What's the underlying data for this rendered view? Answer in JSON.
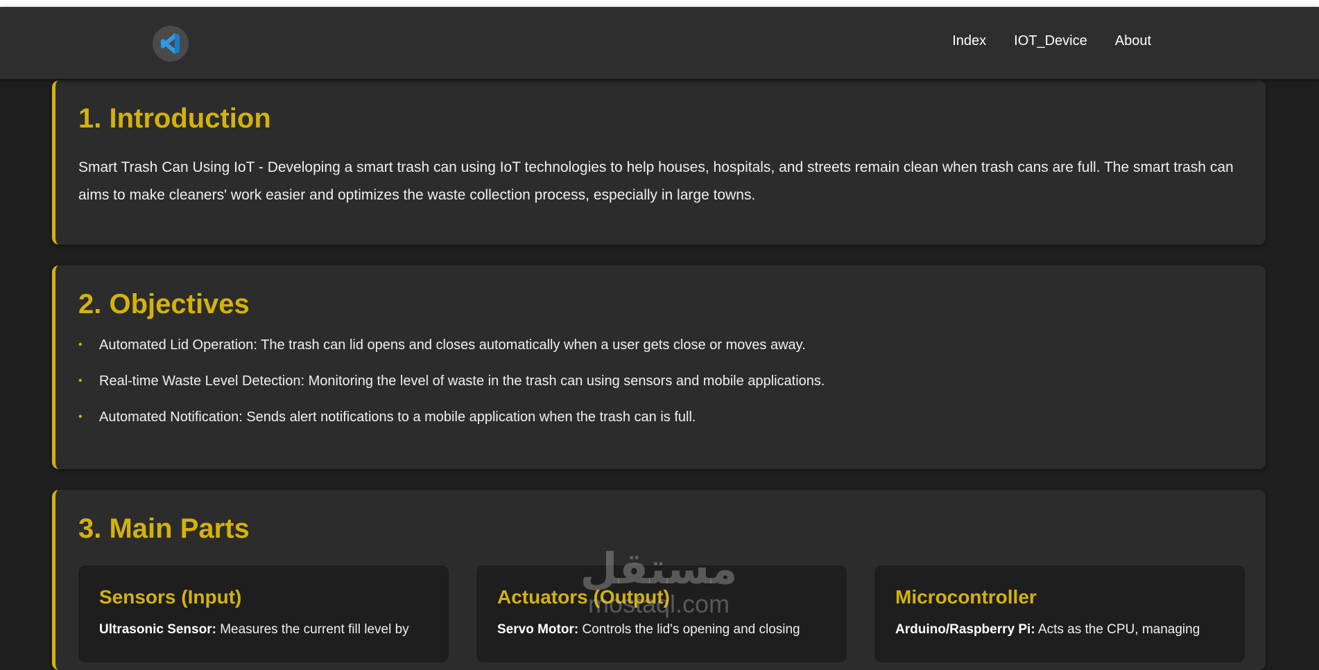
{
  "nav": {
    "logo_icon": "vscode-logo-icon",
    "links": [
      "Index",
      "IOT_Device",
      "About"
    ]
  },
  "intro": {
    "title": "1. Introduction",
    "text": "Smart Trash Can Using IoT - Developing a smart trash can using IoT technologies to help houses, hospitals, and streets remain clean when trash cans are full. The smart trash can aims to make cleaners' work easier and optimizes the waste collection process, especially in large towns."
  },
  "objectives": {
    "title": "2. Objectives",
    "items": [
      "Automated Lid Operation: The trash can lid opens and closes automatically when a user gets close or moves away.",
      "Real-time Waste Level Detection: Monitoring the level of waste in the trash can using sensors and mobile applications.",
      "Automated Notification: Sends alert notifications to a mobile application when the trash can is full."
    ]
  },
  "parts": {
    "title": "3. Main Parts",
    "cards": [
      {
        "title": "Sensors (Input)",
        "term": "Ultrasonic Sensor:",
        "desc": "Measures the current fill level by"
      },
      {
        "title": "Actuators (Output)",
        "term": "Servo Motor:",
        "desc": "Controls the lid's opening and closing"
      },
      {
        "title": "Microcontroller",
        "term": "Arduino/Raspberry Pi:",
        "desc": "Acts as the CPU, managing"
      }
    ]
  },
  "watermark": {
    "arabic": "مستقل",
    "latin": "mostaql.com"
  },
  "colors": {
    "accent": "#d4b20c",
    "background": "#1f1f1f",
    "card": "#2c2c2c",
    "navbar": "#2e2e2e"
  }
}
